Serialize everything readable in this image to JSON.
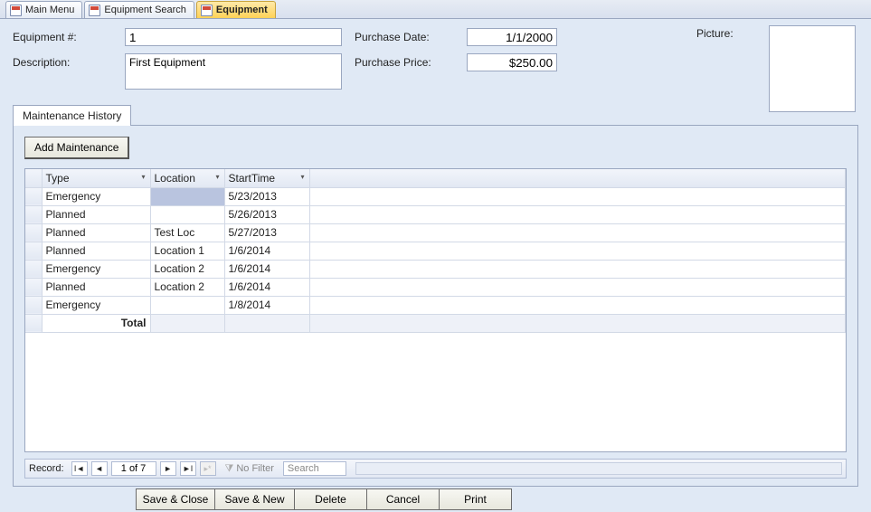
{
  "tabs": {
    "main_menu": "Main Menu",
    "equipment_search": "Equipment Search",
    "equipment": "Equipment"
  },
  "fields": {
    "equipment_num_label": "Equipment #:",
    "equipment_num_value": "1",
    "description_label": "Description:",
    "description_value": "First Equipment",
    "purchase_date_label": "Purchase Date:",
    "purchase_date_value": "1/1/2000",
    "purchase_price_label": "Purchase Price:",
    "purchase_price_value": "$250.00",
    "picture_label": "Picture:"
  },
  "subtab": {
    "label": "Maintenance History",
    "add_button": "Add Maintenance"
  },
  "grid": {
    "headers": {
      "type": "Type",
      "location": "Location",
      "start_time": "StartTime"
    },
    "rows": [
      {
        "type": "Emergency",
        "location": "",
        "start": "5/23/2013"
      },
      {
        "type": "Planned",
        "location": "",
        "start": "5/26/2013"
      },
      {
        "type": "Planned",
        "location": "Test Loc",
        "start": "5/27/2013"
      },
      {
        "type": "Planned",
        "location": "Location 1",
        "start": "1/6/2014"
      },
      {
        "type": "Emergency",
        "location": "Location 2",
        "start": "1/6/2014"
      },
      {
        "type": "Planned",
        "location": "Location 2",
        "start": "1/6/2014"
      },
      {
        "type": "Emergency",
        "location": "",
        "start": "1/8/2014"
      }
    ],
    "total_label": "Total"
  },
  "nav": {
    "record_label": "Record:",
    "position": "1 of 7",
    "no_filter": "No Filter",
    "search_placeholder": "Search"
  },
  "buttons": {
    "save_close": "Save & Close",
    "save_new": "Save & New",
    "delete": "Delete",
    "cancel": "Cancel",
    "print": "Print"
  }
}
